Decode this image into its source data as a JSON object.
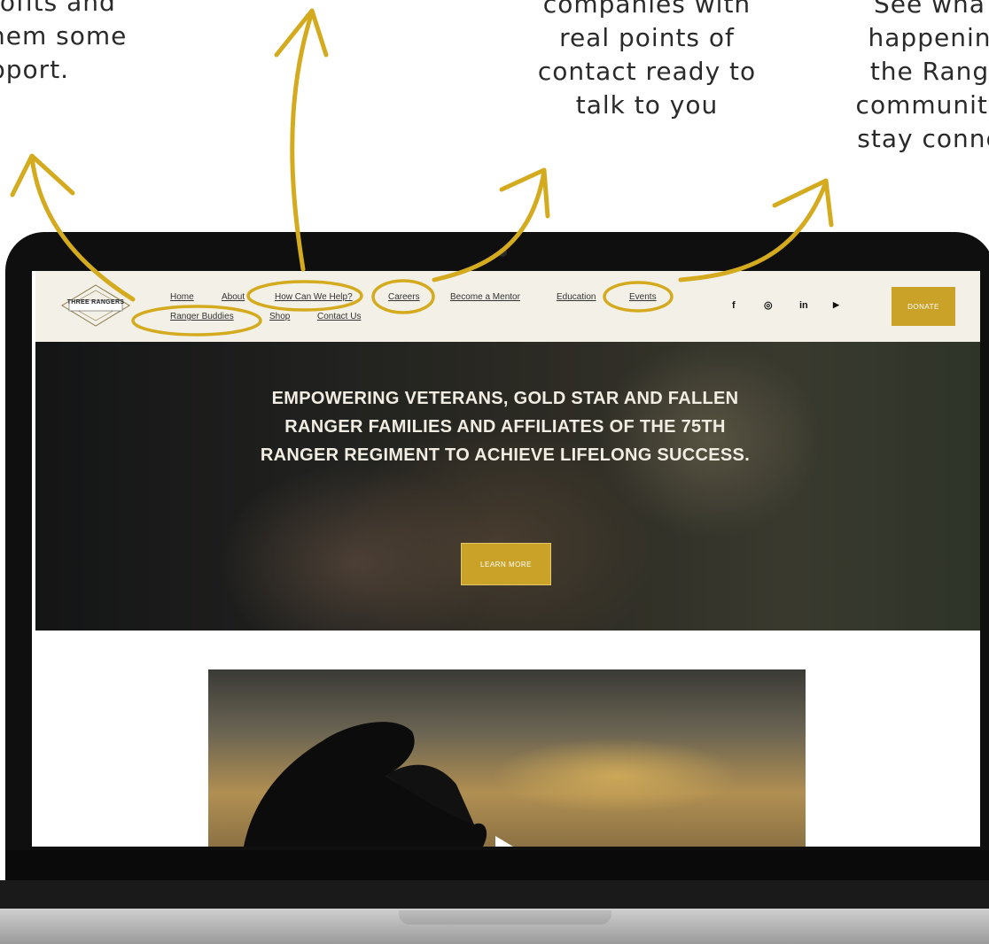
{
  "annotations": {
    "left": [
      "rofits and",
      "hem some",
      "pport."
    ],
    "middle": [
      "companies with",
      "real points of",
      "contact ready to",
      "talk to you"
    ],
    "right": [
      "See wha",
      "happenin",
      "the Rang",
      "community",
      "stay conne"
    ]
  },
  "site": {
    "logo_text": "THREE RANGERS",
    "nav_row1": [
      "Home",
      "About",
      "How Can We Help?",
      "Careers",
      "Become a Mentor",
      "Education",
      "Events"
    ],
    "nav_row2": [
      "Ranger Buddies",
      "Shop",
      "Contact Us"
    ],
    "social_icons": [
      "facebook-icon",
      "instagram-icon",
      "linkedin-icon",
      "youtube-icon"
    ],
    "social_glyphs": [
      "f",
      "◎",
      "in",
      "▶"
    ],
    "donate_label": "DONATE",
    "hero_text": "EMPOWERING VETERANS, GOLD STAR AND FALLEN RANGER FAMILIES AND AFFILIATES OF THE 75TH RANGER REGIMENT TO ACHIEVE LIFELONG SUCCESS.",
    "learn_more_label": "LEARN MORE"
  },
  "colors": {
    "accent": "#c9a227",
    "header_bg": "#f3f0e7",
    "annotation": "#d4aa1e"
  }
}
